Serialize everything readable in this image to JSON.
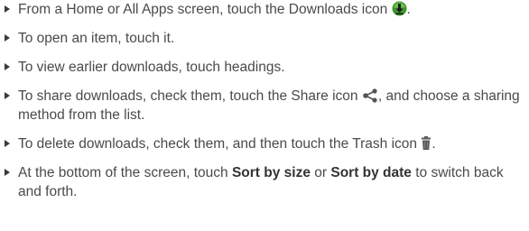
{
  "instructions": [
    {
      "before": "From a Home or All Apps screen, touch the Downloads icon",
      "icon": "downloads-icon",
      "after": "."
    },
    {
      "before": "To open an item, touch it."
    },
    {
      "before": "To view earlier downloads, touch headings."
    },
    {
      "before": "To share downloads, check them, touch the Share icon",
      "icon": "share-icon",
      "after": ", and choose a sharing method from the list."
    },
    {
      "before": "To delete downloads, check them, and then touch the Trash icon",
      "icon": "trash-icon",
      "after": "."
    },
    {
      "before": "At the bottom of the screen, touch ",
      "bold_1": "Sort by size",
      "middle": " or ",
      "bold_2": "Sort by date",
      "after": " to switch back and forth."
    }
  ],
  "colors": {
    "text": "#4a4a4a",
    "bullet": "#3a3a3a",
    "downloads_icon": "#3a8f2d"
  }
}
